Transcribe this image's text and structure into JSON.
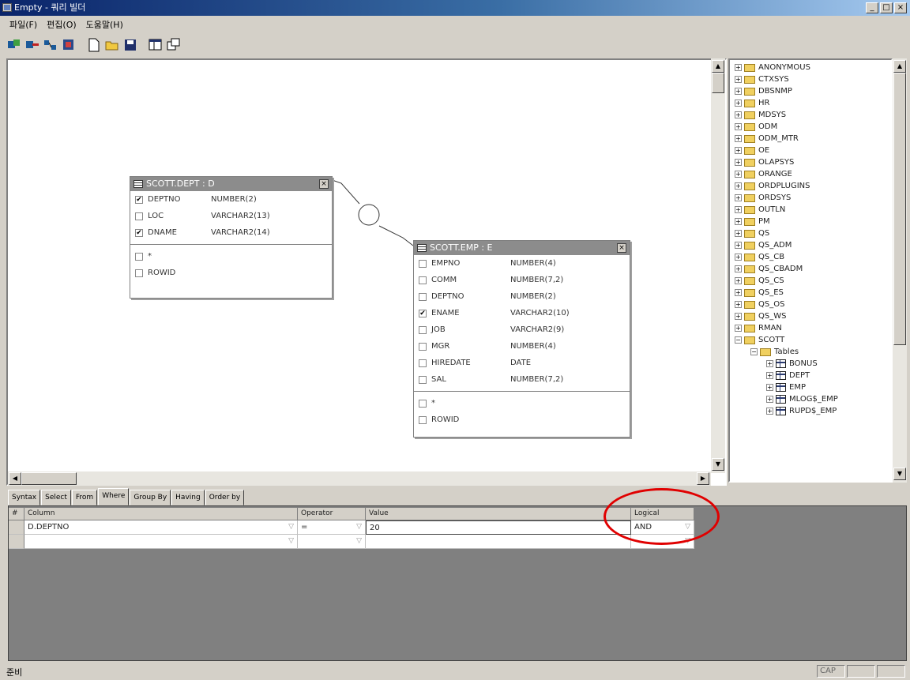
{
  "window": {
    "title": "Empty - 쿼리 빌더",
    "min": "_",
    "max": "□",
    "close": "×"
  },
  "menu": [
    "파일(F)",
    "편집(O)",
    "도움말(H)"
  ],
  "diagram": {
    "dept": {
      "title": "SCOTT.DEPT : D",
      "columns": [
        {
          "name": "DEPTNO",
          "type": "NUMBER(2)",
          "checked": "✔"
        },
        {
          "name": "LOC",
          "type": "VARCHAR2(13)",
          "checked": ""
        },
        {
          "name": "DNAME",
          "type": "VARCHAR2(14)",
          "checked": "✔"
        }
      ],
      "extra": [
        "*",
        "ROWID"
      ]
    },
    "emp": {
      "title": "SCOTT.EMP : E",
      "columns": [
        {
          "name": "EMPNO",
          "type": "NUMBER(4)",
          "checked": ""
        },
        {
          "name": "COMM",
          "type": "NUMBER(7,2)",
          "checked": ""
        },
        {
          "name": "DEPTNO",
          "type": "NUMBER(2)",
          "checked": ""
        },
        {
          "name": "ENAME",
          "type": "VARCHAR2(10)",
          "checked": "✔"
        },
        {
          "name": "JOB",
          "type": "VARCHAR2(9)",
          "checked": ""
        },
        {
          "name": "MGR",
          "type": "NUMBER(4)",
          "checked": ""
        },
        {
          "name": "HIREDATE",
          "type": "DATE",
          "checked": ""
        },
        {
          "name": "SAL",
          "type": "NUMBER(7,2)",
          "checked": ""
        }
      ],
      "extra": [
        "*",
        "ROWID"
      ]
    }
  },
  "tree": {
    "schemas": [
      "ANONYMOUS",
      "CTXSYS",
      "DBSNMP",
      "HR",
      "MDSYS",
      "ODM",
      "ODM_MTR",
      "OE",
      "OLAPSYS",
      "ORANGE",
      "ORDPLUGINS",
      "ORDSYS",
      "OUTLN",
      "PM",
      "QS",
      "QS_ADM",
      "QS_CB",
      "QS_CBADM",
      "QS_CS",
      "QS_ES",
      "QS_OS",
      "QS_WS",
      "RMAN"
    ],
    "open_schema": "SCOTT",
    "tables_folder": "Tables",
    "tables": [
      "BONUS",
      "DEPT",
      "EMP",
      "MLOG$_EMP",
      "RUPD$_EMP"
    ]
  },
  "tabs": [
    "Syntax",
    "Select",
    "From",
    "Where",
    "Group By",
    "Having",
    "Order by"
  ],
  "grid": {
    "headers": {
      "num": "#",
      "column": "Column",
      "operator": "Operator",
      "value": "Value",
      "logical": "Logical"
    },
    "rows": [
      {
        "column": "D.DEPTNO",
        "operator": "=",
        "value": "20",
        "logical": "AND"
      },
      {
        "column": "",
        "operator": "",
        "value": "",
        "logical": ""
      }
    ]
  },
  "status": {
    "text": "준비",
    "cap": "CAP"
  },
  "colors": {
    "annotation": "#e00000",
    "title_gradient_start": "#0a246a"
  }
}
